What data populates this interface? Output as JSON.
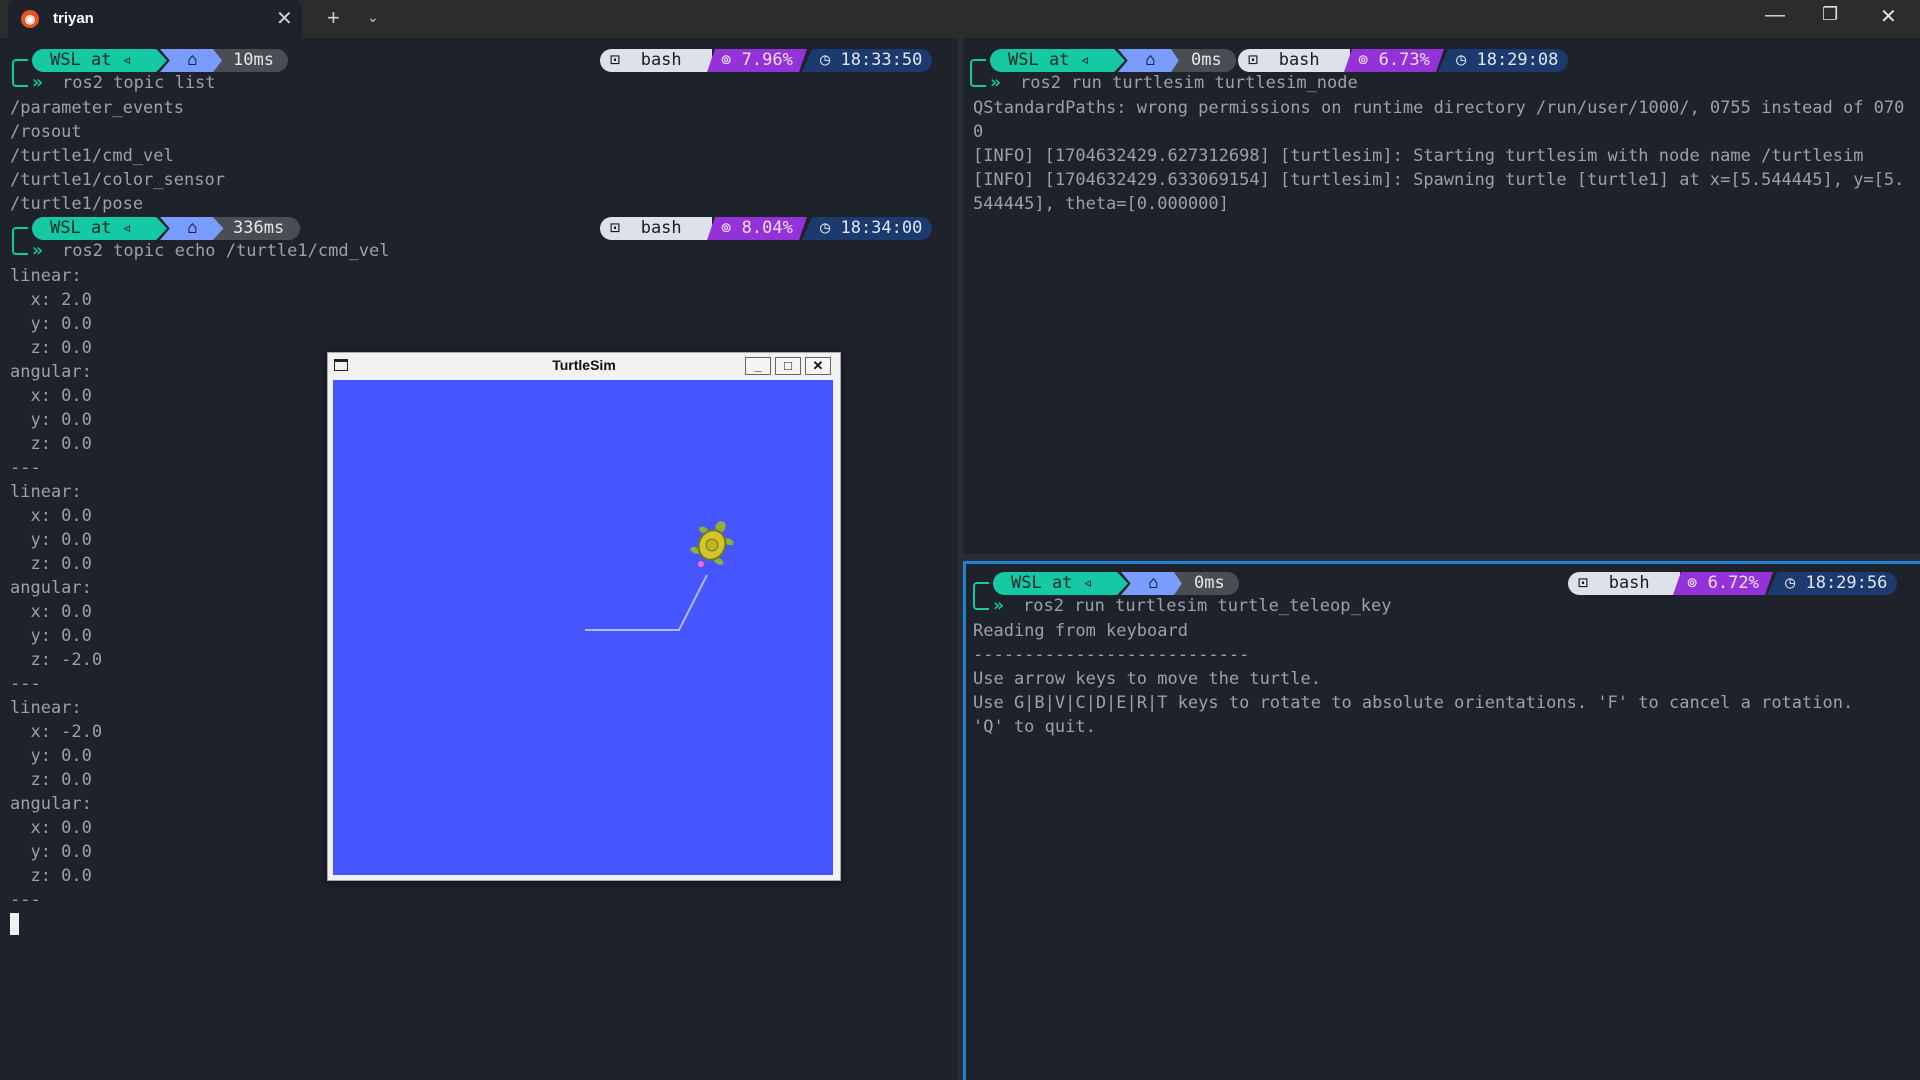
{
  "window": {
    "tab_title": "triyan",
    "tab_close": "✕",
    "new_tab": "+",
    "tab_dropdown": "⌄",
    "minimize": "—",
    "restore": "❐",
    "close": "✕"
  },
  "left_pane": {
    "prompt1": {
      "wsl": "WSL at ◃",
      "home": "⌂",
      "duration": "10ms",
      "shell": "⊡  bash",
      "cpu": "⊚ 7.96%",
      "time": "◷ 18:33:50",
      "command": "ros2 topic list"
    },
    "topics": [
      "/parameter_events",
      "/rosout",
      "/turtle1/cmd_vel",
      "/turtle1/color_sensor",
      "/turtle1/pose"
    ],
    "prompt2": {
      "wsl": "WSL at ◃",
      "home": "⌂",
      "duration": "336ms",
      "shell": "⊡  bash",
      "cpu": "⊚ 8.04%",
      "time": "◷ 18:34:00",
      "command": "ros2 topic echo /turtle1/cmd_vel"
    },
    "echo_lines": [
      "linear:",
      "  x: 2.0",
      "  y: 0.0",
      "  z: 0.0",
      "angular:",
      "  x: 0.0",
      "  y: 0.0",
      "  z: 0.0",
      "---",
      "linear:",
      "  x: 0.0",
      "  y: 0.0",
      "  z: 0.0",
      "angular:",
      "  x: 0.0",
      "  y: 0.0",
      "  z: -2.0",
      "---",
      "linear:",
      "  x: -2.0",
      "  y: 0.0",
      "  z: 0.0",
      "angular:",
      "  x: 0.0",
      "  y: 0.0",
      "  z: 0.0",
      "---"
    ]
  },
  "top_right_pane": {
    "prompt": {
      "wsl": "WSL at ◃",
      "home": "⌂",
      "duration": "0ms",
      "shell": "⊡  bash",
      "cpu": "⊚ 6.73%",
      "time": "◷ 18:29:08",
      "command": "ros2 run turtlesim turtlesim_node"
    },
    "output": [
      "QStandardPaths: wrong permissions on runtime directory /run/user/1000/, 0755 instead of 070",
      "0",
      "[INFO] [1704632429.627312698] [turtlesim]: Starting turtlesim with node name /turtlesim",
      "[INFO] [1704632429.633069154] [turtlesim]: Spawning turtle [turtle1] at x=[5.544445], y=[5.",
      "544445], theta=[0.000000]"
    ]
  },
  "bottom_right_pane": {
    "prompt": {
      "wsl": "WSL at ◃",
      "home": "⌂",
      "duration": "0ms",
      "shell": "⊡  bash",
      "cpu": "⊚ 6.72%",
      "time": "◷ 18:29:56",
      "command": "ros2 run turtlesim turtle_teleop_key"
    },
    "output": [
      "Reading from keyboard",
      "---------------------------",
      "Use arrow keys to move the turtle.",
      "Use G|B|V|C|D|E|R|T keys to rotate to absolute orientations. 'F' to cancel a rotation.",
      "'Q' to quit."
    ]
  },
  "turtlesim": {
    "title": "TurtleSim",
    "minimize": "_",
    "maximize": "□",
    "close": "✕",
    "background_color": "#4556ff",
    "pen_color": "#b3b8ff"
  },
  "colors": {
    "terminal_bg": "#1e222b",
    "wsl_segment": "#14c9a4",
    "home_segment": "#7a9cff",
    "cpu_segment": "#9232d8",
    "time_segment": "#1d3a6e",
    "focus_border": "#1f84d8"
  }
}
